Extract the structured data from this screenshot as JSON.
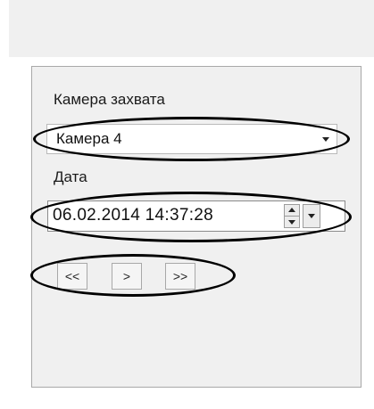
{
  "camera": {
    "label": "Камера захвата",
    "selected": "Камера 4"
  },
  "date": {
    "label": "Дата",
    "value": "06.02.2014 14:37:28"
  },
  "navigation": {
    "first_label": "<<",
    "next_label": ">",
    "last_label": ">>"
  },
  "icons": {
    "combo_arrow": "chevron-down-icon",
    "spin_up": "triangle-up-icon",
    "spin_down": "triangle-down-icon",
    "date_dropdown": "triangle-down-icon"
  },
  "colors": {
    "panel_background": "#f0f0f0",
    "border": "#a8a8a8",
    "highlight_ellipse": "#000000"
  }
}
